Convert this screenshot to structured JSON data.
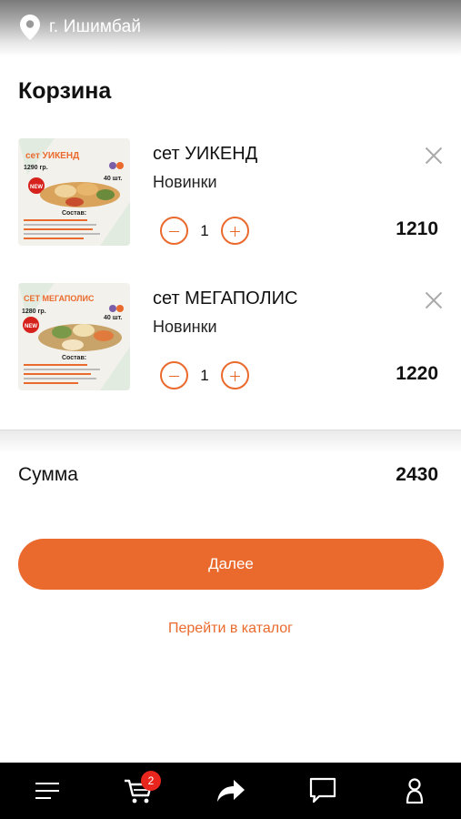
{
  "header": {
    "city": "г. Ишимбай"
  },
  "page": {
    "title": "Корзина"
  },
  "cart": {
    "items": [
      {
        "title": "сет УИКЕНД",
        "category": "Новинки",
        "quantity": "1",
        "price": "1210",
        "image": {
          "banner": "сет УИКЕНД",
          "weight": "1290 гр.",
          "pieces": "40 шт.",
          "badge": "NEW",
          "contents_label": "Состав:"
        }
      },
      {
        "title": "сет МЕГАПОЛИС",
        "category": "Новинки",
        "quantity": "1",
        "price": "1220",
        "image": {
          "banner": "СЕТ МЕГАПОЛИС",
          "weight": "1280 гр.",
          "pieces": "40 шт.",
          "badge": "NEW",
          "contents_label": "Состав:"
        }
      }
    ]
  },
  "summary": {
    "label": "Сумма",
    "value": "2430"
  },
  "actions": {
    "next_label": "Далее",
    "catalog_link": "Перейти в каталог"
  },
  "tabbar": {
    "items": [
      {
        "icon": "menu-icon"
      },
      {
        "icon": "cart-icon",
        "badge": "2"
      },
      {
        "icon": "share-icon"
      },
      {
        "icon": "chat-icon"
      },
      {
        "icon": "profile-icon"
      }
    ]
  },
  "colors": {
    "accent": "#ea6a2d",
    "badge": "#e8261e",
    "tabbar_bg": "#000000"
  }
}
